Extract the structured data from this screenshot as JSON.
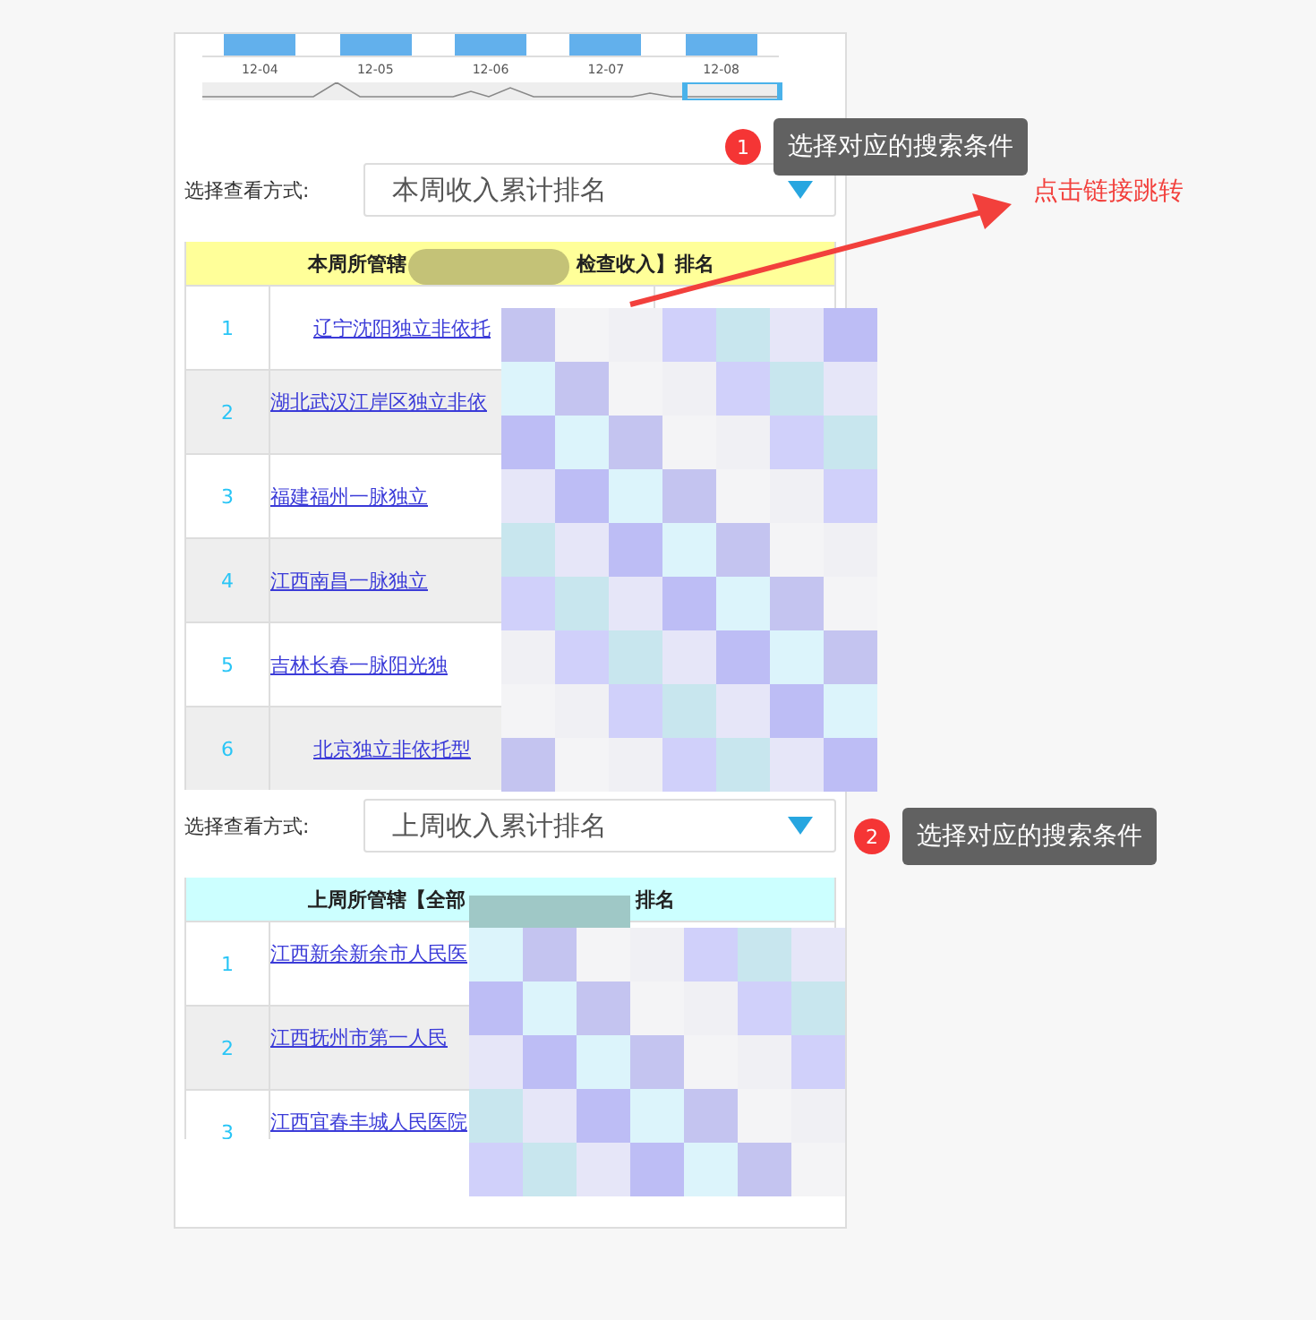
{
  "overview": {
    "dates": [
      "12-04",
      "12-05",
      "12-06",
      "12-07",
      "12-08"
    ]
  },
  "sections": [
    {
      "filter": {
        "label": "选择查看方式:",
        "value": "本周收入累计排名"
      },
      "table": {
        "color": "#ffff99",
        "header_start": "本周所管辖",
        "header_end": "检查收入】排名",
        "rows": [
          {
            "rank": "1",
            "name": "辽宁沈阳独立非依托",
            "kind": "centered"
          },
          {
            "rank": "2",
            "name": "湖北武汉江岸区独立非依",
            "kind": "top"
          },
          {
            "rank": "3",
            "name": "福建福州一脉独立",
            "kind": "plain"
          },
          {
            "rank": "4",
            "name": "江西南昌一脉独立",
            "kind": "plain"
          },
          {
            "rank": "5",
            "name": "吉林长春一脉阳光独",
            "kind": "plain"
          },
          {
            "rank": "6",
            "name": "北京独立非依托型",
            "kind": "centered"
          }
        ]
      }
    },
    {
      "filter": {
        "label": "选择查看方式:",
        "value": "上周收入累计排名"
      },
      "table": {
        "color": "#ccffff",
        "header_start": "上周所管辖【全部",
        "header_end": "排名",
        "rows": [
          {
            "rank": "1",
            "name": "江西新余新余市人民医",
            "kind": "top"
          },
          {
            "rank": "2",
            "name": "江西抚州市第一人民",
            "kind": "top"
          },
          {
            "rank": "3",
            "name": "江西宜春丰城人民医院",
            "kind": "top"
          }
        ]
      }
    }
  ],
  "annotations": [
    {
      "kind": "tooltip",
      "badge": "1",
      "text": "选择对应的搜索条件"
    },
    {
      "kind": "arrow-label",
      "text": "点击链接跳转"
    },
    {
      "kind": "tooltip",
      "badge": "2",
      "text": "选择对应的搜索条件"
    }
  ]
}
